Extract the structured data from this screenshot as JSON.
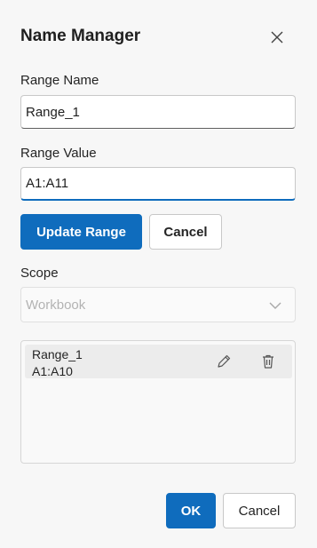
{
  "dialog": {
    "title": "Name Manager",
    "close_icon": "close-icon"
  },
  "range_name": {
    "label": "Range Name",
    "value": "Range_1"
  },
  "range_value": {
    "label": "Range Value",
    "value": "A1:A11"
  },
  "actions": {
    "update_label": "Update Range",
    "cancel_label": "Cancel"
  },
  "scope": {
    "label": "Scope",
    "selected": "Workbook",
    "icon": "chevron-down-icon"
  },
  "ranges": {
    "items": [
      {
        "name": "Range_1",
        "range": "A1:A10",
        "edit_icon": "edit-icon",
        "delete_icon": "delete-icon"
      }
    ]
  },
  "footer": {
    "ok_label": "OK",
    "cancel_label": "Cancel"
  },
  "colors": {
    "accent": "#0f6cbd",
    "background": "#f7f7f7",
    "list_item_bg": "#ececec"
  }
}
